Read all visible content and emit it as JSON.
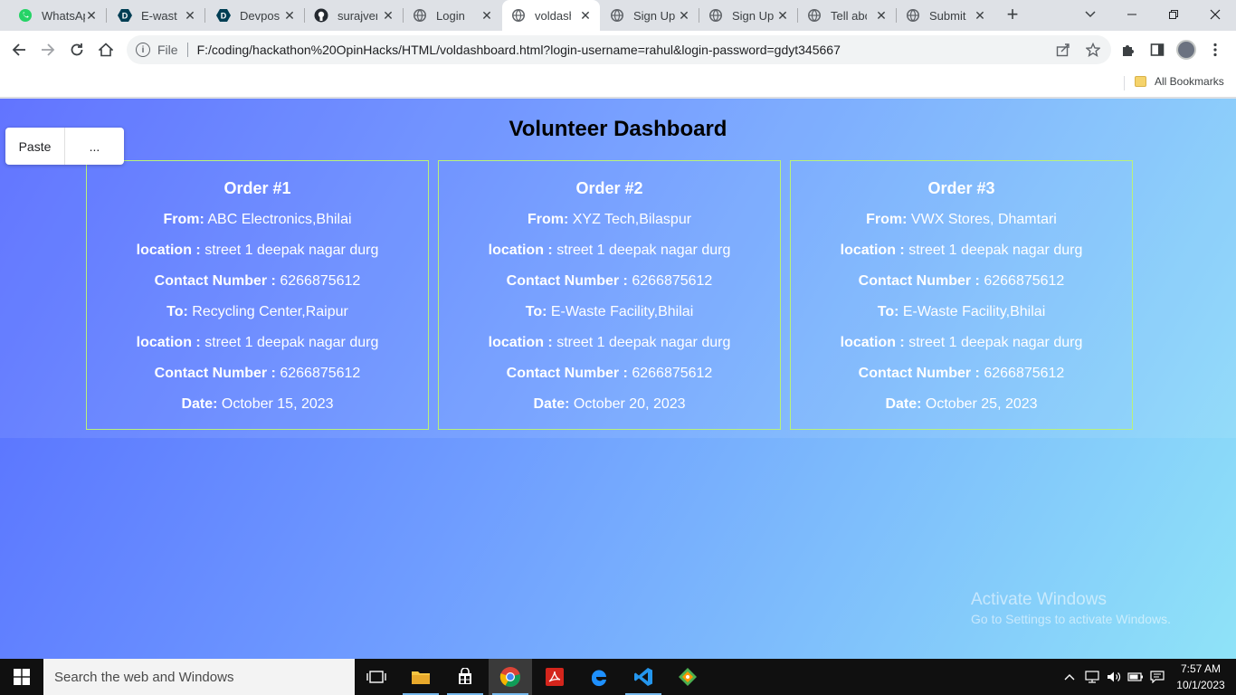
{
  "browser": {
    "tabs": [
      {
        "title": "WhatsApp",
        "icon": "whatsapp-icon",
        "active": false
      },
      {
        "title": "E-waste",
        "icon": "devpost-icon",
        "active": false
      },
      {
        "title": "Devpost",
        "icon": "devpost-icon",
        "active": false
      },
      {
        "title": "surajverma",
        "icon": "github-icon",
        "active": false
      },
      {
        "title": "Login",
        "icon": "globe-icon",
        "active": false
      },
      {
        "title": "voldashboard",
        "icon": "globe-icon",
        "active": true
      },
      {
        "title": "Sign Up",
        "icon": "globe-icon",
        "active": false
      },
      {
        "title": "Sign Up",
        "icon": "globe-icon",
        "active": false
      },
      {
        "title": "Tell about",
        "icon": "globe-icon",
        "active": false
      },
      {
        "title": "Submit",
        "icon": "globe-icon",
        "active": false
      }
    ],
    "new_tab": "+",
    "address": {
      "scheme": "File",
      "url": "F:/coding/hackathon%20OpinHacks/HTML/voldashboard.html?login-username=rahul&login-password=gdyt345667"
    },
    "bookmarks": {
      "folder": "All Bookmarks"
    }
  },
  "page": {
    "title": "Volunteer Dashboard",
    "orders": [
      {
        "heading": "Order #1",
        "from_label": "From:",
        "from": "ABC Electronics,Bhilai",
        "location_label": "location :",
        "from_location": "street 1 deepak nagar durg",
        "contact_label": "Contact Number :",
        "from_contact": "6266875612",
        "to_label": "To:",
        "to": "Recycling Center,Raipur",
        "to_location": "street 1 deepak nagar durg",
        "to_contact": "6266875612",
        "date_label": "Date:",
        "date": "October 15, 2023"
      },
      {
        "heading": "Order #2",
        "from_label": "From:",
        "from": "XYZ Tech,Bilaspur",
        "location_label": "location :",
        "from_location": "street 1 deepak nagar durg",
        "contact_label": "Contact Number :",
        "from_contact": "6266875612",
        "to_label": "To:",
        "to": "E-Waste Facility,Bhilai",
        "to_location": "street 1 deepak nagar durg",
        "to_contact": "6266875612",
        "date_label": "Date:",
        "date": "October 20, 2023"
      },
      {
        "heading": "Order #3",
        "from_label": "From:",
        "from": "VWX Stores, Dhamtari",
        "location_label": "location :",
        "from_location": "street 1 deepak nagar durg",
        "contact_label": "Contact Number :",
        "from_contact": "6266875612",
        "to_label": "To:",
        "to": "E-Waste Facility,Bhilai",
        "to_location": "street 1 deepak nagar durg",
        "to_contact": "6266875612",
        "date_label": "Date:",
        "date": "October 25, 2023"
      }
    ]
  },
  "context_menu": {
    "paste": "Paste",
    "more": "..."
  },
  "watermark": {
    "title": "Activate Windows",
    "subtitle": "Go to Settings to activate Windows."
  },
  "taskbar": {
    "search_placeholder": "Search the web and Windows",
    "time": "7:57 AM",
    "date": "10/1/2023"
  },
  "colors": {
    "page_gradient_start": "#5569ff",
    "page_gradient_end": "#8fe3f8",
    "card_border": "#b9f27a"
  }
}
